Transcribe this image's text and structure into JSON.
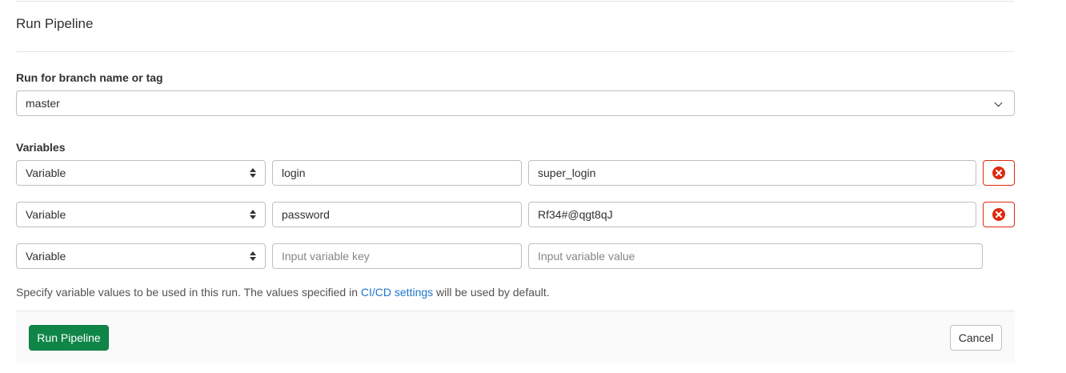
{
  "title": "Run Pipeline",
  "branch": {
    "label": "Run for branch name or tag",
    "value": "master",
    "icon": "chevron-down-icon"
  },
  "variables": {
    "label": "Variables",
    "rows": [
      {
        "type": "Variable",
        "key": "login",
        "value": "super_login",
        "removable": true
      },
      {
        "type": "Variable",
        "key": "password",
        "value": "Rf34#@qgt8qJ",
        "removable": true
      },
      {
        "type": "Variable",
        "key": "",
        "value": "",
        "removable": false
      }
    ],
    "key_placeholder": "Input variable key",
    "value_placeholder": "Input variable value",
    "remove_icon": "remove-circle-icon",
    "remove_color": "#dd2b0e"
  },
  "help": {
    "before": "Specify variable values to be used in this run. The values specified in ",
    "link": "CI/CD settings",
    "after": " will be used by default."
  },
  "footer": {
    "run_label": "Run Pipeline",
    "cancel_label": "Cancel",
    "run_color": "#108548"
  }
}
